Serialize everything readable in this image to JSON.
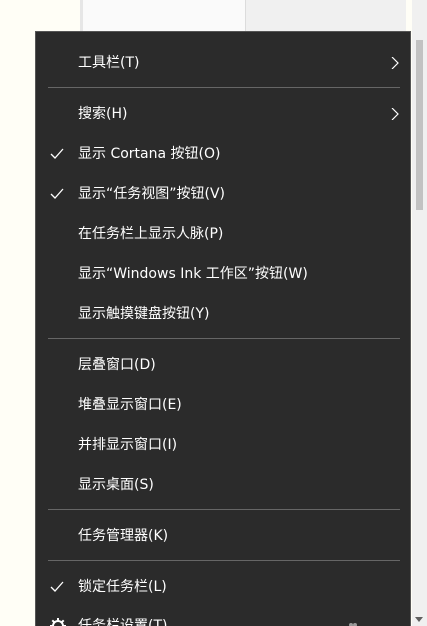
{
  "menu": {
    "items": [
      {
        "label": "工具栏(T)",
        "checked": false,
        "submenu": true
      },
      {
        "label": "搜索(H)",
        "checked": false,
        "submenu": true
      },
      {
        "label": "显示 Cortana 按钮(O)",
        "checked": true,
        "submenu": false
      },
      {
        "label": "显示“任务视图”按钮(V)",
        "checked": true,
        "submenu": false
      },
      {
        "label": "在任务栏上显示人脉(P)",
        "checked": false,
        "submenu": false
      },
      {
        "label": "显示“Windows Ink 工作区”按钮(W)",
        "checked": false,
        "submenu": false
      },
      {
        "label": "显示触摸键盘按钮(Y)",
        "checked": false,
        "submenu": false
      },
      {
        "label": "层叠窗口(D)",
        "checked": false,
        "submenu": false
      },
      {
        "label": "堆叠显示窗口(E)",
        "checked": false,
        "submenu": false
      },
      {
        "label": "并排显示窗口(I)",
        "checked": false,
        "submenu": false
      },
      {
        "label": "显示桌面(S)",
        "checked": false,
        "submenu": false
      },
      {
        "label": "任务管理器(K)",
        "checked": false,
        "submenu": false
      },
      {
        "label": "锁定任务栏(L)",
        "checked": true,
        "submenu": false
      },
      {
        "label": "任务栏设置(T)",
        "checked": false,
        "submenu": false,
        "icon": "gear-icon"
      }
    ]
  },
  "colors": {
    "menu_background": "#2b2b2b",
    "menu_text": "#ffffff",
    "separator": "#666666"
  }
}
